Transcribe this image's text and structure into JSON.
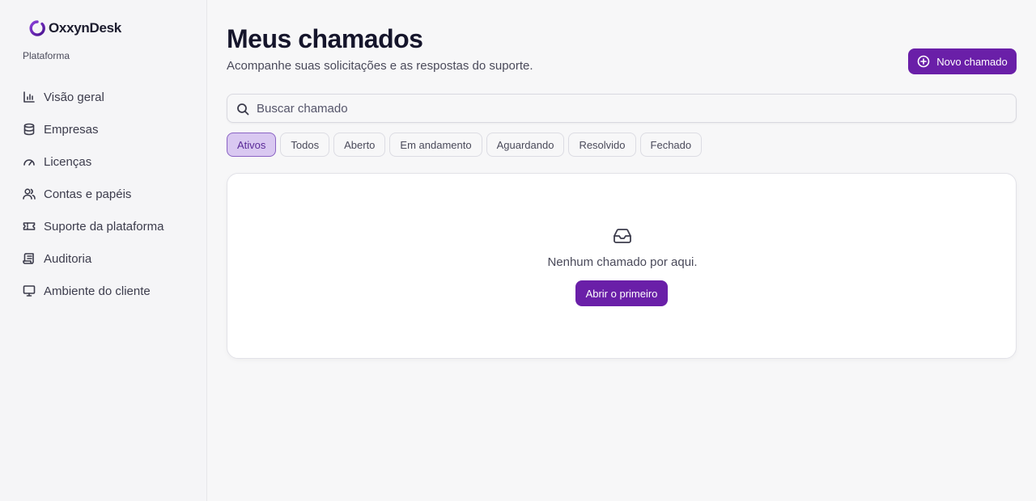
{
  "brand": {
    "name": "OxxynDesk",
    "accent": "#6a1fa8"
  },
  "sidebar": {
    "section_label": "Plataforma",
    "items": [
      {
        "label": "Visão geral",
        "icon": "bar-chart-icon"
      },
      {
        "label": "Empresas",
        "icon": "database-icon"
      },
      {
        "label": "Licenças",
        "icon": "gauge-icon"
      },
      {
        "label": "Contas e papéis",
        "icon": "users-icon"
      },
      {
        "label": "Suporte da plataforma",
        "icon": "ticket-icon"
      },
      {
        "label": "Auditoria",
        "icon": "scroll-icon"
      },
      {
        "label": "Ambiente do cliente",
        "icon": "monitor-icon"
      }
    ]
  },
  "page": {
    "title": "Meus chamados",
    "subtitle": "Acompanhe suas solicitações e as respostas do suporte.",
    "new_button": "Novo chamado"
  },
  "search": {
    "placeholder": "Buscar chamado",
    "value": ""
  },
  "filters": {
    "active": "Ativos",
    "items": [
      "Ativos",
      "Todos",
      "Aberto",
      "Em andamento",
      "Aguardando",
      "Resolvido",
      "Fechado"
    ]
  },
  "empty_state": {
    "message": "Nenhum chamado por aqui.",
    "button": "Abrir o primeiro"
  }
}
